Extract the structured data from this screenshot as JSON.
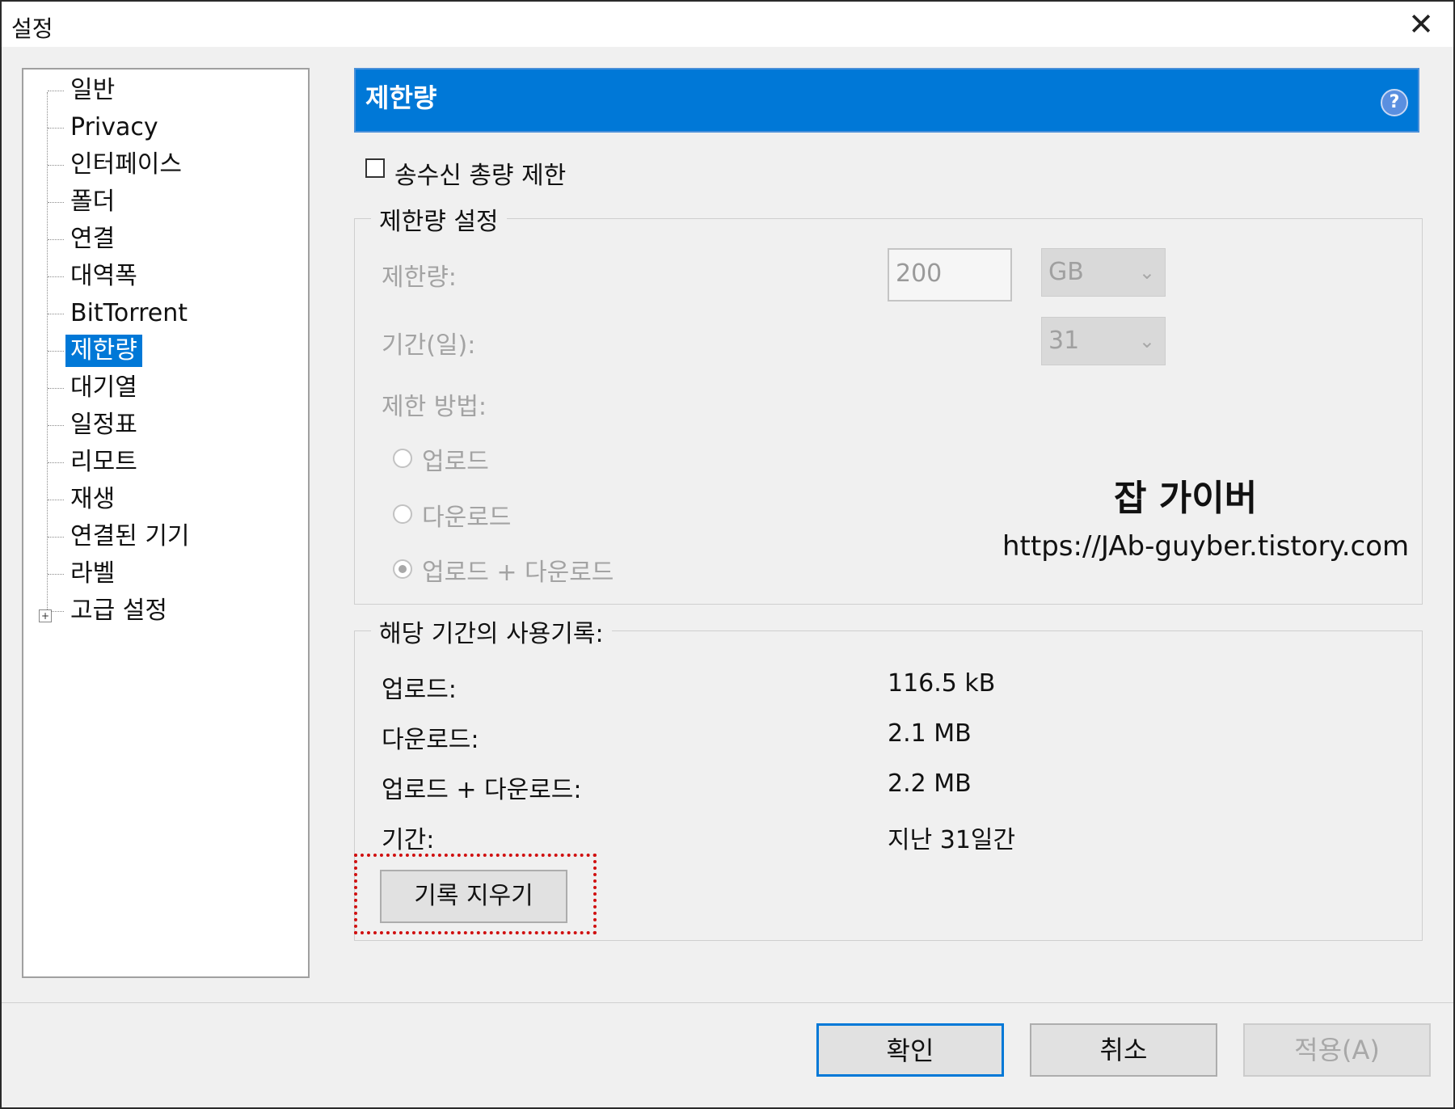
{
  "window": {
    "title": "설정"
  },
  "nav": {
    "items": [
      {
        "label": "일반"
      },
      {
        "label": "Privacy"
      },
      {
        "label": "인터페이스"
      },
      {
        "label": "폴더"
      },
      {
        "label": "연결"
      },
      {
        "label": "대역폭"
      },
      {
        "label": "BitTorrent"
      },
      {
        "label": "제한량"
      },
      {
        "label": "대기열"
      },
      {
        "label": "일정표"
      },
      {
        "label": "리모트"
      },
      {
        "label": "재생"
      },
      {
        "label": "연결된 기기"
      },
      {
        "label": "라벨"
      },
      {
        "label": "고급 설정"
      }
    ],
    "selected_index": 7,
    "expandable_item": "고급 설정"
  },
  "page": {
    "header_title": "제한량",
    "help_icon": "?",
    "limit_checkbox": {
      "label": "송수신 총량 제한",
      "checked": false
    },
    "settings_group": {
      "title": "제한량 설정",
      "limit_label": "제한량:",
      "limit_value": "200",
      "unit_value": "GB",
      "period_label": "기간(일):",
      "period_value": "31",
      "method_label": "제한 방법:",
      "methods": [
        {
          "label": "업로드",
          "checked": false
        },
        {
          "label": "다운로드",
          "checked": false
        },
        {
          "label": "업로드 + 다운로드",
          "checked": true
        }
      ]
    },
    "watermark": {
      "name": "잡 가이버",
      "url": "https://JAb-guyber.tistory.com"
    },
    "usage_group": {
      "title": "해당 기간의 사용기록:",
      "rows": [
        {
          "label": "업로드:",
          "value": "116.5 kB"
        },
        {
          "label": "다운로드:",
          "value": "2.1 MB"
        },
        {
          "label": "업로드 + 다운로드:",
          "value": "2.2 MB"
        },
        {
          "label": "기간:",
          "value": "지난 31일간"
        }
      ],
      "clear_button": "기록 지우기"
    }
  },
  "footer": {
    "ok": "확인",
    "cancel": "취소",
    "apply": "적용(A)"
  },
  "colors": {
    "accent": "#0078d7",
    "highlight": "#d01010",
    "disabled_text": "#a3a3a3"
  }
}
